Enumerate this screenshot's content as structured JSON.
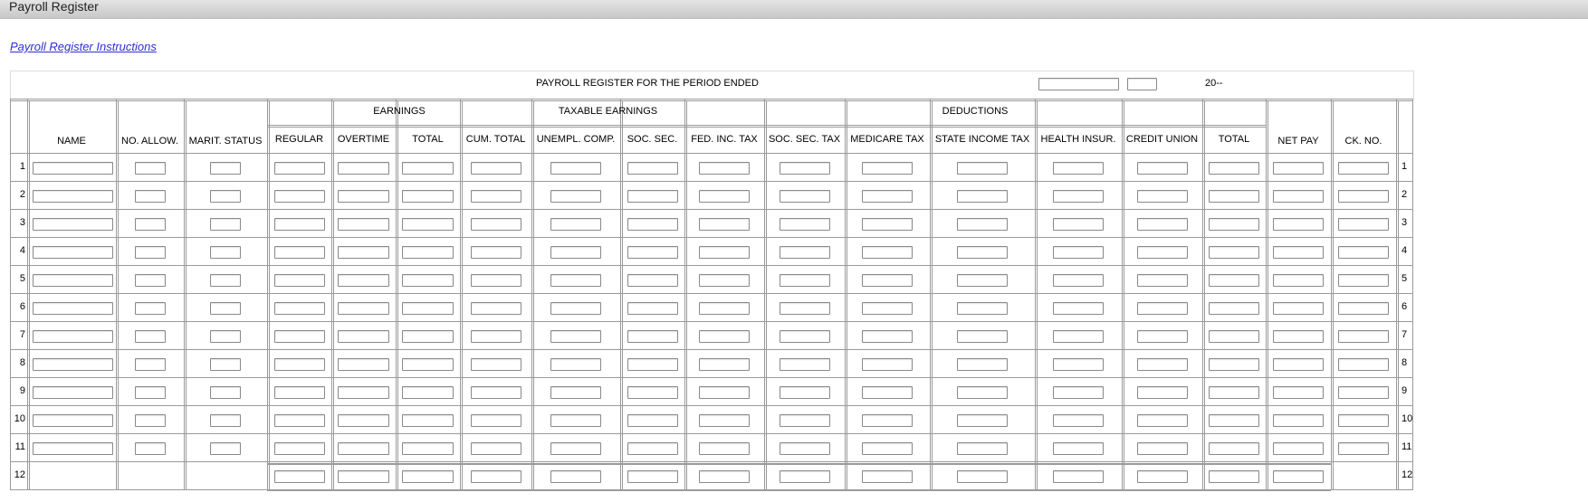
{
  "window": {
    "title": "Payroll Register"
  },
  "instructions_link": "Payroll Register Instructions",
  "header": {
    "period_label": "PAYROLL REGISTER FOR THE PERIOD ENDED",
    "year_prefix": "20--",
    "date_value": "",
    "year_value": ""
  },
  "groups": {
    "earnings": "EARNINGS",
    "taxable": "TAXABLE EARNINGS",
    "deductions": "DEDUCTIONS"
  },
  "columns": [
    {
      "key": "name",
      "label": "NAME"
    },
    {
      "key": "no_allow",
      "label": "NO. ALLOW."
    },
    {
      "key": "marit_status",
      "label": "MARIT. STATUS"
    },
    {
      "key": "regular",
      "label": "REGULAR"
    },
    {
      "key": "overtime",
      "label": "OVERTIME"
    },
    {
      "key": "earn_total",
      "label": "TOTAL"
    },
    {
      "key": "cum_total",
      "label": "CUM. TOTAL"
    },
    {
      "key": "unempl_comp",
      "label": "UNEMPL. COMP."
    },
    {
      "key": "soc_sec",
      "label": "SOC. SEC."
    },
    {
      "key": "fed_inc_tax",
      "label": "FED. INC. TAX"
    },
    {
      "key": "soc_sec_tax",
      "label": "SOC. SEC. TAX"
    },
    {
      "key": "medicare_tax",
      "label": "MEDICARE TAX"
    },
    {
      "key": "state_income_tax",
      "label": "STATE INCOME TAX"
    },
    {
      "key": "health_insur",
      "label": "HEALTH INSUR."
    },
    {
      "key": "credit_union",
      "label": "CREDIT UNION"
    },
    {
      "key": "ded_total",
      "label": "TOTAL"
    },
    {
      "key": "net_pay",
      "label": "NET PAY"
    },
    {
      "key": "ck_no",
      "label": "CK. NO."
    }
  ],
  "row_numbers": [
    "1",
    "2",
    "3",
    "4",
    "5",
    "6",
    "7",
    "8",
    "9",
    "10",
    "11",
    "12"
  ],
  "total_row_number": "12"
}
